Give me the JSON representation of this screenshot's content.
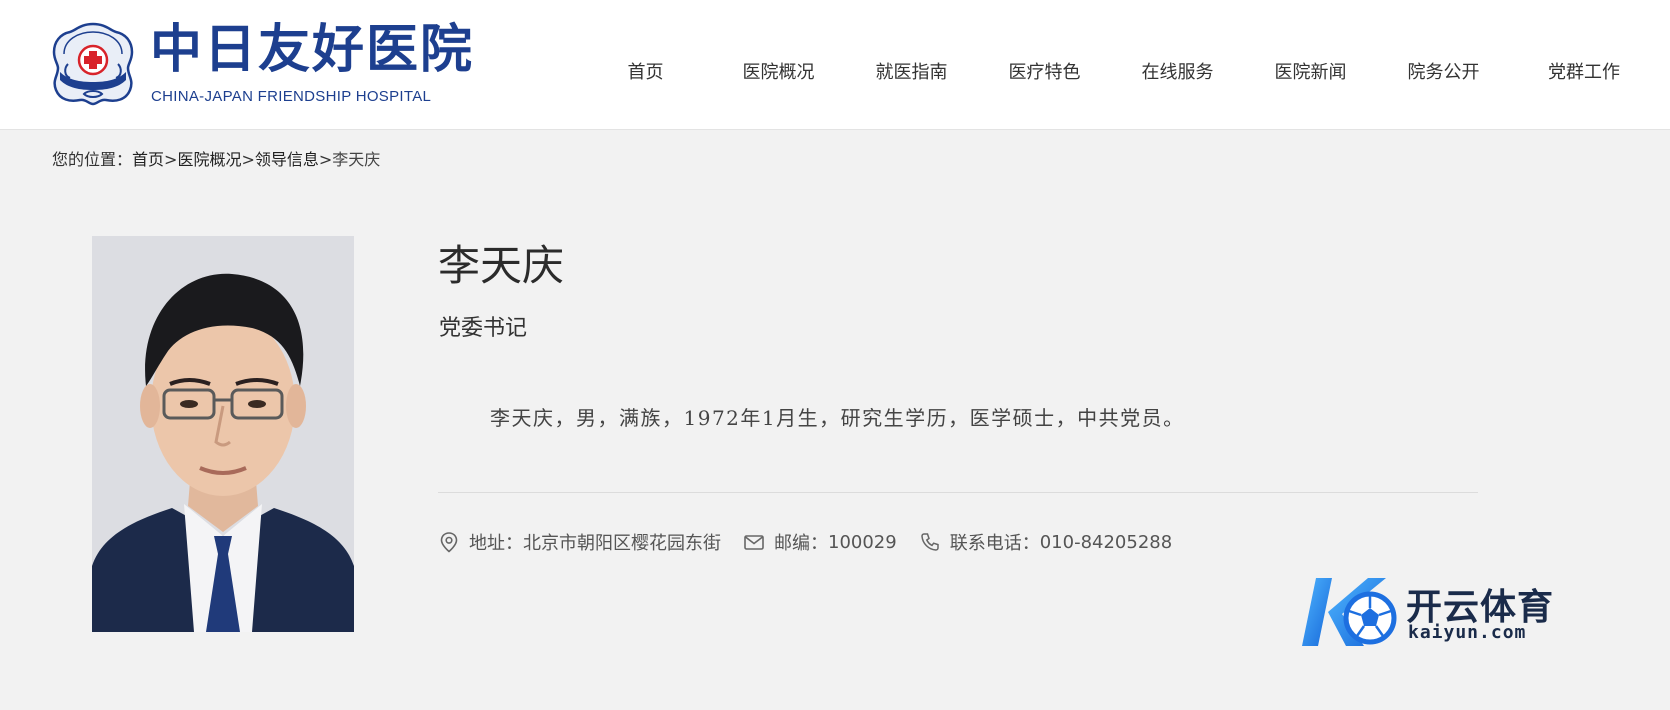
{
  "header": {
    "logo": {
      "name_cn": "中日友好医院",
      "name_en": "CHINA-JAPAN FRIENDSHIP HOSPITAL",
      "emblem_text": "中日友好医院",
      "emblem_icon": "hospital-emblem-icon",
      "brand_color": "#1d3f8f"
    },
    "nav": [
      {
        "label": "首页"
      },
      {
        "label": "医院概况"
      },
      {
        "label": "就医指南"
      },
      {
        "label": "医疗特色"
      },
      {
        "label": "在线服务"
      },
      {
        "label": "医院新闻"
      },
      {
        "label": "院务公开"
      },
      {
        "label": "党群工作"
      }
    ]
  },
  "breadcrumb": {
    "prefix": "您的位置：",
    "items": [
      "首页",
      "医院概况",
      "领导信息"
    ],
    "separator": ">",
    "current": "李天庆"
  },
  "profile": {
    "name": "李天庆",
    "title": "党委书记",
    "bio": "李天庆，男，满族，1972年1月生，研究生学历，医学硕士，中共党员。"
  },
  "contact": {
    "address_label": "地址：",
    "address": "北京市朝阳区樱花园东街",
    "postcode_label": "邮编：",
    "postcode": "100029",
    "phone_label": "联系电话：",
    "phone": "010-84205288",
    "icons": [
      "location-pin-icon",
      "mail-icon",
      "phone-icon"
    ]
  },
  "watermark": {
    "text_cn": "开云体育",
    "text_en": "kaiyun.com",
    "accent": "#2a8ff0"
  }
}
